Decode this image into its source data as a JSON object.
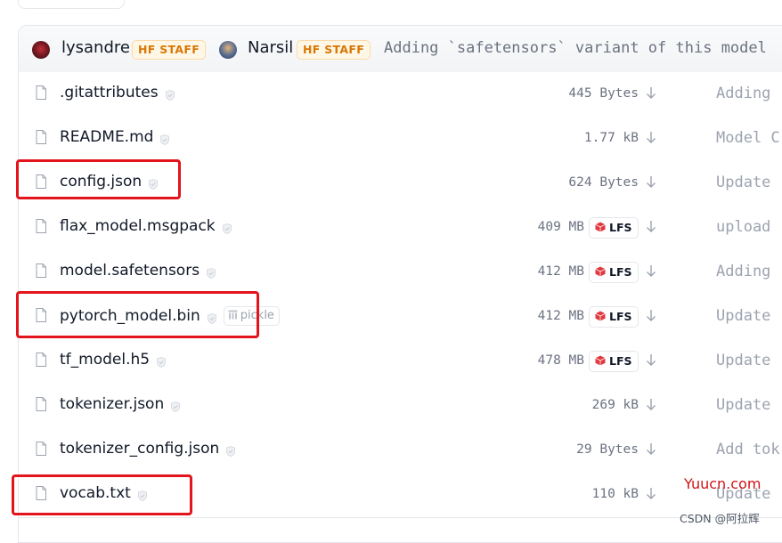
{
  "commit": {
    "author1": "lysandre",
    "author2": "Narsil",
    "badge": "HF STAFF",
    "message": "Adding `safetensors` variant of this model"
  },
  "files": [
    {
      "name": ".gitattributes",
      "size": "445 Bytes",
      "lfs": false,
      "commit": "Adding"
    },
    {
      "name": "README.md",
      "size": "1.77 kB",
      "lfs": false,
      "commit": "Model C"
    },
    {
      "name": "config.json",
      "size": "624 Bytes",
      "lfs": false,
      "commit": "Update"
    },
    {
      "name": "flax_model.msgpack",
      "size": "409 MB",
      "lfs": true,
      "commit": "upload"
    },
    {
      "name": "model.safetensors",
      "size": "412 MB",
      "lfs": true,
      "commit": "Adding"
    },
    {
      "name": "pytorch_model.bin",
      "size": "412 MB",
      "lfs": true,
      "commit": "Update",
      "pickle": "pickle"
    },
    {
      "name": "tf_model.h5",
      "size": "478 MB",
      "lfs": true,
      "commit": "Update"
    },
    {
      "name": "tokenizer.json",
      "size": "269 kB",
      "lfs": false,
      "commit": "Update"
    },
    {
      "name": "tokenizer_config.json",
      "size": "29 Bytes",
      "lfs": false,
      "commit": "Add tok"
    },
    {
      "name": "vocab.txt",
      "size": "110 kB",
      "lfs": false,
      "commit": "Update"
    }
  ],
  "lfs_label": "LFS",
  "icons": {
    "file": "file-icon",
    "shield": "shield-check-icon",
    "download": "download-arrow-icon",
    "lfs": "lfs-cube-icon",
    "pickle": "pickle-icon"
  },
  "colors": {
    "badge_text": "#d97706",
    "lfs_cube": "#e0393e",
    "highlight": "#e3141c"
  },
  "highlighted_files": [
    "config.json",
    "pytorch_model.bin",
    "vocab.txt"
  ],
  "watermark": {
    "site": "Yuucn.com",
    "credit": "CSDN @阿拉辉"
  }
}
